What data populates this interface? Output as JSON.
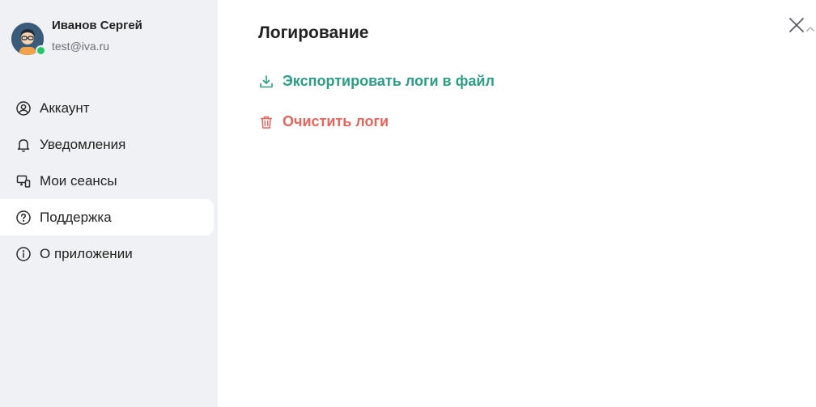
{
  "profile": {
    "name": "Иванов Сергей",
    "email": "test@iva.ru",
    "status_color": "#27c46b"
  },
  "sidebar": {
    "items": [
      {
        "label": "Аккаунт",
        "icon": "user-circle-icon",
        "active": false
      },
      {
        "label": "Уведомления",
        "icon": "bell-icon",
        "active": false
      },
      {
        "label": "Мои сеансы",
        "icon": "devices-icon",
        "active": false
      },
      {
        "label": "Поддержка",
        "icon": "question-circle-icon",
        "active": true
      },
      {
        "label": "О приложении",
        "icon": "info-circle-icon",
        "active": false
      }
    ]
  },
  "main": {
    "title": "Логирование",
    "actions": {
      "export_label": "Экспортировать логи в файл",
      "export_icon": "download-icon",
      "export_color": "#2c9d82",
      "clear_label": "Очистить логи",
      "clear_icon": "trash-icon",
      "clear_color": "#e2665c"
    },
    "close_icon": "close-icon"
  },
  "colors": {
    "sidebar_bg": "#f0f1f5",
    "main_bg": "#ffffff",
    "text": "#222222",
    "muted": "#6d6f76"
  }
}
